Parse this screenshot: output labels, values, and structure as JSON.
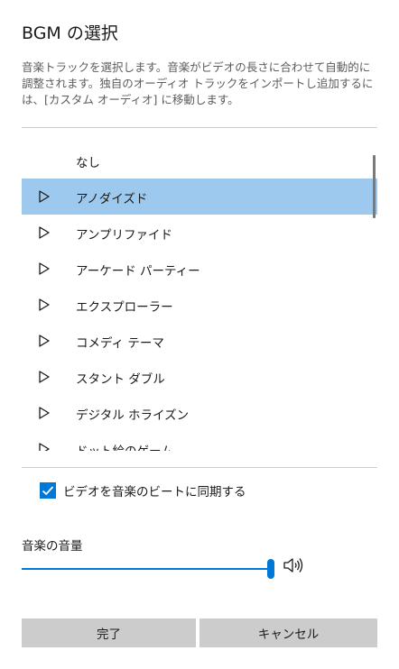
{
  "dialog": {
    "title": "BGM の選択",
    "description": "音楽トラックを選択します。音楽がビデオの長さに合わせて自動的に調整されます。独自のオーディオ トラックをインポートし追加するには、[カスタム オーディオ] に移動します。"
  },
  "tracks": [
    {
      "label": "なし",
      "has_play": false,
      "selected": false
    },
    {
      "label": "アノダイズド",
      "has_play": true,
      "selected": true
    },
    {
      "label": "アンプリファイド",
      "has_play": true,
      "selected": false
    },
    {
      "label": "アーケード パーティー",
      "has_play": true,
      "selected": false
    },
    {
      "label": "エクスプローラー",
      "has_play": true,
      "selected": false
    },
    {
      "label": "コメディ テーマ",
      "has_play": true,
      "selected": false
    },
    {
      "label": "スタント ダブル",
      "has_play": true,
      "selected": false
    },
    {
      "label": "デジタル ホライズン",
      "has_play": true,
      "selected": false
    },
    {
      "label": "ドット絵のゲーム",
      "has_play": true,
      "selected": false
    }
  ],
  "sync": {
    "label": "ビデオを音楽のビートに同期する",
    "checked": true
  },
  "volume": {
    "label": "音楽の音量",
    "value_percent": 100
  },
  "buttons": {
    "done": "完了",
    "cancel": "キャンセル"
  },
  "colors": {
    "accent": "#0078d7",
    "selected_row": "#9ec9ee",
    "button_bg": "#cccccc"
  }
}
